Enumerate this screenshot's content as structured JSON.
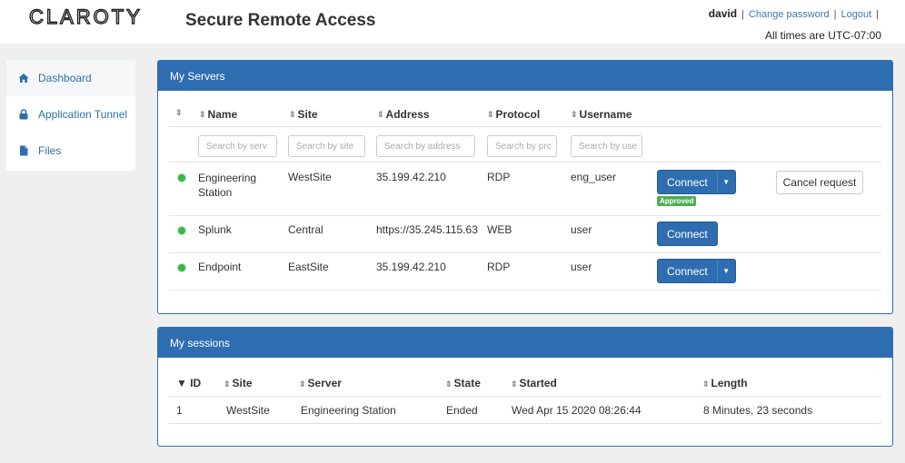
{
  "header": {
    "logo_text": "CLAROTY",
    "title": "Secure Remote Access",
    "username": "david",
    "change_password": "Change password",
    "logout": "Logout",
    "timezone_note": "All times are UTC-07:00"
  },
  "sidebar": {
    "items": [
      {
        "label": "Dashboard",
        "icon": "home-icon"
      },
      {
        "label": "Application Tunnel",
        "icon": "lock-icon"
      },
      {
        "label": "Files",
        "icon": "file-icon"
      }
    ]
  },
  "servers": {
    "title": "My Servers",
    "columns": [
      "Name",
      "Site",
      "Address",
      "Protocol",
      "Username"
    ],
    "filters": {
      "name": "Search by serv",
      "site": "Search by site",
      "address": "Search by address",
      "protocol": "Search by prc",
      "username": "Search by use"
    },
    "rows": [
      {
        "status": "online",
        "name": "Engineering Station",
        "site": "WestSite",
        "address": "35.199.42.210",
        "protocol": "RDP",
        "username": "eng_user",
        "connect": "Connect",
        "badge": "Approved",
        "cancel": "Cancel request"
      },
      {
        "status": "online",
        "name": "Splunk",
        "site": "Central",
        "address": "https://35.245.115.63",
        "protocol": "WEB",
        "username": "user",
        "connect": "Connect"
      },
      {
        "status": "online",
        "name": "Endpoint",
        "site": "EastSite",
        "address": "35.199.42.210",
        "protocol": "RDP",
        "username": "user",
        "connect": "Connect"
      }
    ]
  },
  "sessions": {
    "title": "My sessions",
    "columns": [
      "ID",
      "Site",
      "Server",
      "State",
      "Started",
      "Length"
    ],
    "rows": [
      {
        "id": "1",
        "site": "WestSite",
        "server": "Engineering Station",
        "state": "Ended",
        "started": "Wed Apr 15 2020 08:26:44",
        "length": "8 Minutes, 23 seconds"
      }
    ]
  },
  "colors": {
    "primary": "#2f6db1",
    "online": "#39b54a",
    "approved": "#4caf50",
    "link": "#3b7ab8"
  }
}
